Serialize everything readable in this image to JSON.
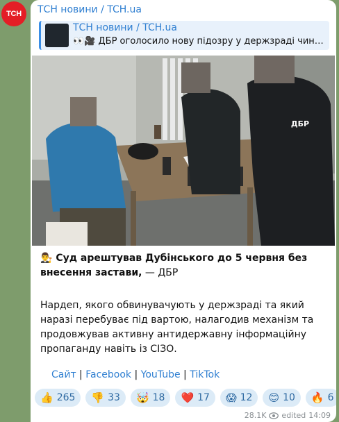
{
  "channel": {
    "avatar_text": "ТСН",
    "name": "ТСН новини / TCH.ua"
  },
  "reply": {
    "title": "ТСН новини / TCH.ua",
    "text": "👀🎥 ДБР оголосило нову підозру у держзраді чинно..."
  },
  "post": {
    "headline_emoji": "👨‍⚖️",
    "headline_bold": "Суд арештував Дубінського до 5 червня без внесення застави,",
    "headline_tail": " — ДБР",
    "body": "Нардеп, якого обвинувачують у держзраді та який наразі перебуває під вартою, налагодив механізм та продовжував активну антидержавну інформаційну пропаганду навіть із СІЗО.",
    "vest_text": "ДБР"
  },
  "links": [
    {
      "label": "Сайт"
    },
    {
      "label": "Facebook"
    },
    {
      "label": "YouTube"
    },
    {
      "label": "TikTok"
    }
  ],
  "link_separator": " | ",
  "reactions": [
    {
      "emoji": "👍",
      "count": "265",
      "icon": "thumbs-up-icon"
    },
    {
      "emoji": "👎",
      "count": "33",
      "icon": "thumbs-down-icon"
    },
    {
      "emoji": "🤯",
      "count": "18",
      "icon": "mind-blown-icon"
    },
    {
      "emoji": "❤️",
      "count": "17",
      "icon": "heart-icon"
    },
    {
      "emoji": "😱",
      "count": "12",
      "icon": "scream-icon"
    },
    {
      "emoji": "😊",
      "count": "10",
      "icon": "smile-icon"
    },
    {
      "emoji": "🔥",
      "count": "6",
      "icon": "fire-icon"
    }
  ],
  "meta": {
    "views": "28.1K",
    "edited": "edited",
    "time": "14:09"
  },
  "colors": {
    "accent": "#2f7fd1",
    "bubble": "#ffffff",
    "background": "#7e9c6c",
    "avatar": "#e41e26"
  }
}
